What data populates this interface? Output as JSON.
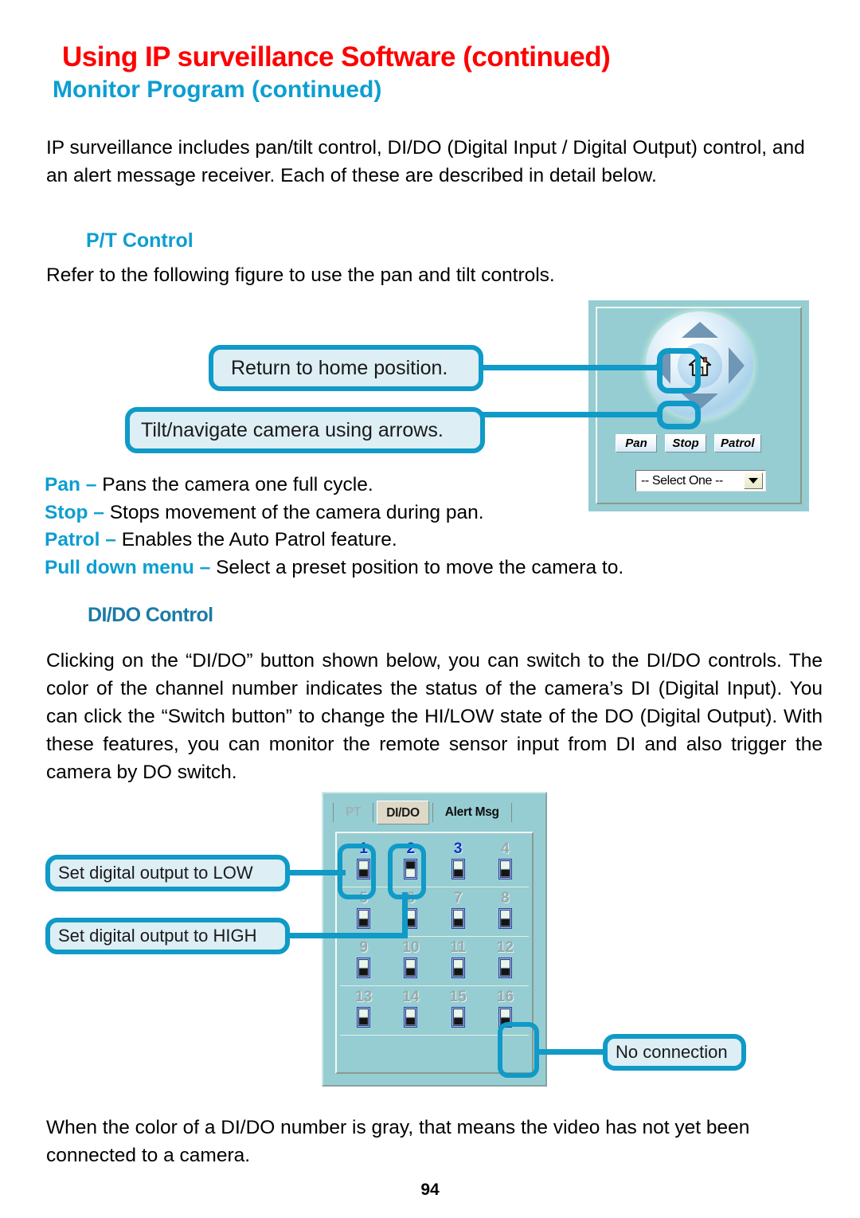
{
  "document": {
    "title_main": "Using IP surveillance Software (continued)",
    "title_sub": "Monitor Program (continued)",
    "page_number": "94",
    "intro_paragraph": "IP surveillance includes pan/tilt control, DI/DO (Digital Input / Digital Output) control, and an alert message receiver. Each of these are described in detail below.",
    "colors": {
      "title_red": "#ff0000",
      "heading_cyan": "#0c9ed1",
      "heading_blue": "#1b7ba6",
      "callout_border": "#0f9ac8",
      "callout_fill": "#ddeef5",
      "panel_teal": "#95cdd3",
      "channel_on": "#1330c8",
      "channel_off": "#9aa8a9"
    }
  },
  "pt_section": {
    "heading": "P/T Control",
    "intro": "Refer to the following figure to use the pan and tilt controls.",
    "callouts": [
      {
        "id": "home",
        "text": "Return to home position."
      },
      {
        "id": "tilt",
        "text": "Tilt/navigate camera using arrows."
      }
    ],
    "key_list": [
      {
        "term": "Pan",
        "dash": " – ",
        "desc": "Pans the camera one full cycle."
      },
      {
        "term": "Stop",
        "dash": " – ",
        "desc": "Stops movement of the camera during pan."
      },
      {
        "term": "Patrol",
        "dash": " – ",
        "desc": "Enables the Auto Patrol feature."
      },
      {
        "term": "Pull down menu",
        "dash": " – ",
        "desc": "Select a preset position to move the camera to."
      }
    ],
    "panel": {
      "buttons": [
        {
          "name": "pan",
          "label": "Pan"
        },
        {
          "name": "stop",
          "label": "Stop"
        },
        {
          "name": "patrol",
          "label": "Patrol"
        }
      ],
      "preset_select": {
        "value": "-- Select One --",
        "icon": "chevron-down-icon"
      },
      "dpad": {
        "up": "arrow-up-icon",
        "down": "arrow-down-icon",
        "left": "arrow-left-icon",
        "right": "arrow-right-icon",
        "center": "home-icon"
      }
    }
  },
  "dido_section": {
    "heading": "DI/DO Control",
    "paragraph": "Clicking on the “DI/DO” button shown below, you can switch to the DI/DO controls. The color of the channel number indicates the status of the camera’s DI (Digital Input). You can click the “Switch button” to change the HI/LOW state of the DO (Digital Output). With these features, you can monitor the remote sensor input from DI and also trigger the camera by DO switch.",
    "footer_paragraph": "When the color of a DI/DO number is gray, that means the video has not yet been connected to a camera.",
    "callouts": [
      {
        "id": "low",
        "text": "Set digital output to LOW"
      },
      {
        "id": "high",
        "text": "Set digital output to HIGH"
      },
      {
        "id": "noconn",
        "text": "No connection"
      }
    ],
    "panel": {
      "tabs": [
        {
          "name": "pt",
          "label": "PT",
          "selected": false
        },
        {
          "name": "dido",
          "label": "DI/DO",
          "selected": true
        },
        {
          "name": "alert",
          "label": "Alert Msg",
          "selected": false
        }
      ],
      "channels": [
        {
          "num": "1",
          "connected": true,
          "switch": "switch-low-icon"
        },
        {
          "num": "2",
          "connected": true,
          "switch": "switch-high-icon"
        },
        {
          "num": "3",
          "connected": true,
          "switch": "switch-low-icon"
        },
        {
          "num": "4",
          "connected": false,
          "switch": "switch-low-icon"
        },
        {
          "num": "5",
          "connected": false,
          "switch": "switch-low-icon"
        },
        {
          "num": "6",
          "connected": false,
          "switch": "switch-low-icon"
        },
        {
          "num": "7",
          "connected": false,
          "switch": "switch-low-icon"
        },
        {
          "num": "8",
          "connected": false,
          "switch": "switch-low-icon"
        },
        {
          "num": "9",
          "connected": false,
          "switch": "switch-low-icon"
        },
        {
          "num": "10",
          "connected": false,
          "switch": "switch-low-icon"
        },
        {
          "num": "11",
          "connected": false,
          "switch": "switch-low-icon"
        },
        {
          "num": "12",
          "connected": false,
          "switch": "switch-low-icon"
        },
        {
          "num": "13",
          "connected": false,
          "switch": "switch-low-icon"
        },
        {
          "num": "14",
          "connected": false,
          "switch": "switch-low-icon"
        },
        {
          "num": "15",
          "connected": false,
          "switch": "switch-low-icon"
        },
        {
          "num": "16",
          "connected": false,
          "switch": "switch-low-icon"
        }
      ]
    }
  }
}
